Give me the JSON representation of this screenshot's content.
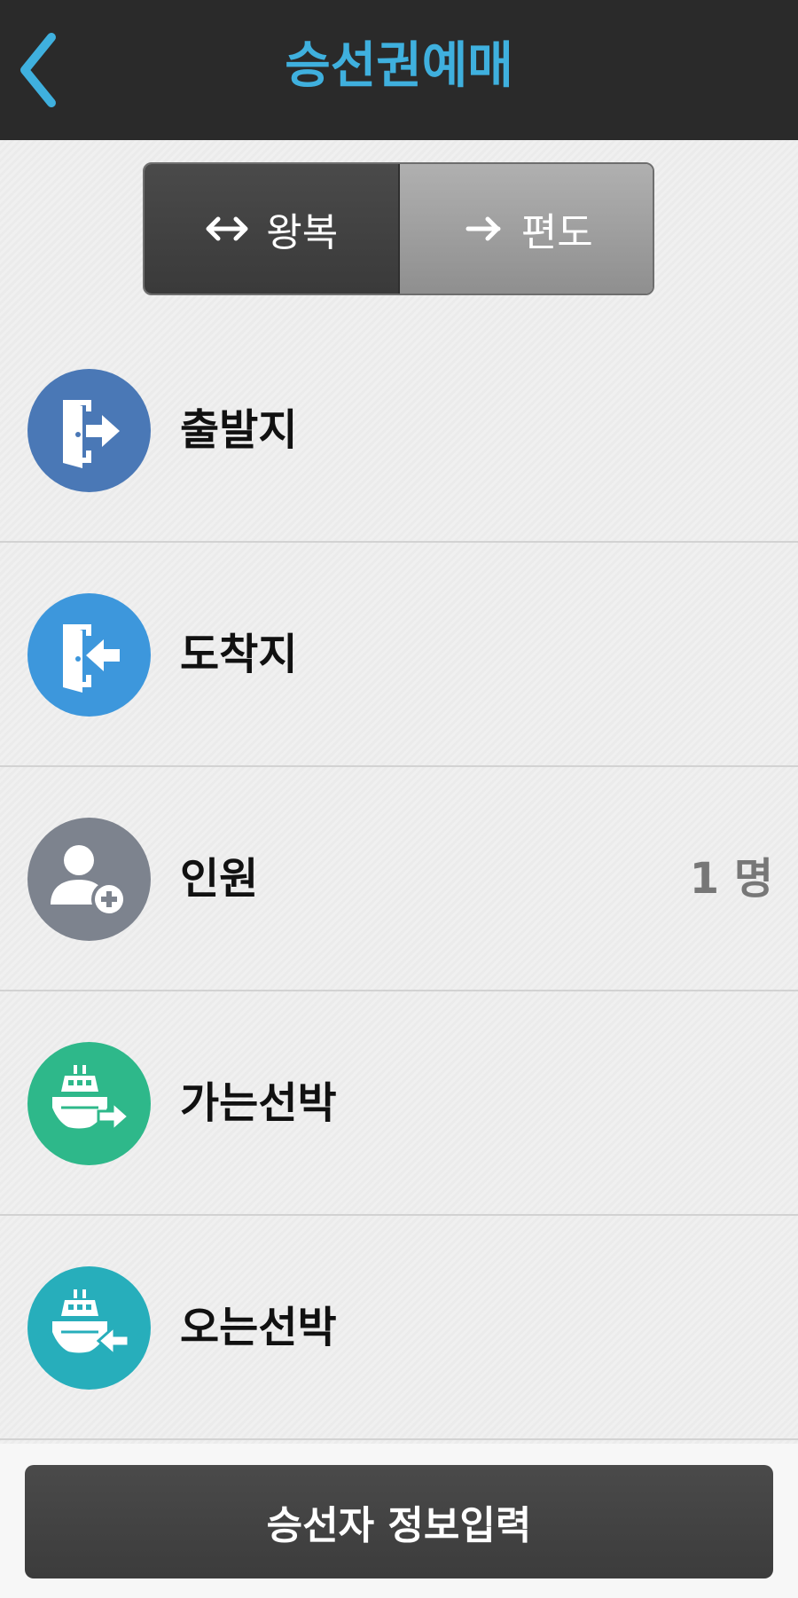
{
  "header": {
    "title": "승선권예매",
    "back_icon": "chevron-left-icon",
    "accent_color": "#3fb0de"
  },
  "trip_toggle": {
    "options": [
      {
        "label": "왕복",
        "icon": "double-arrow-icon",
        "selected": true
      },
      {
        "label": "편도",
        "icon": "arrow-right-icon",
        "selected": false
      }
    ]
  },
  "rows": [
    {
      "label": "출발지",
      "icon": "exit-door-icon",
      "color": "#4a78b6",
      "value": ""
    },
    {
      "label": "도착지",
      "icon": "enter-door-icon",
      "color": "#3d97dc",
      "value": ""
    },
    {
      "label": "인원",
      "icon": "add-person-icon",
      "color": "#7d838e",
      "value": "1 명"
    },
    {
      "label": "가는선박",
      "icon": "ship-depart-icon",
      "color": "#2eb88a",
      "value": ""
    },
    {
      "label": "오는선박",
      "icon": "ship-return-icon",
      "color": "#27aebb",
      "value": ""
    }
  ],
  "footer": {
    "submit_label": "승선자 정보입력"
  }
}
